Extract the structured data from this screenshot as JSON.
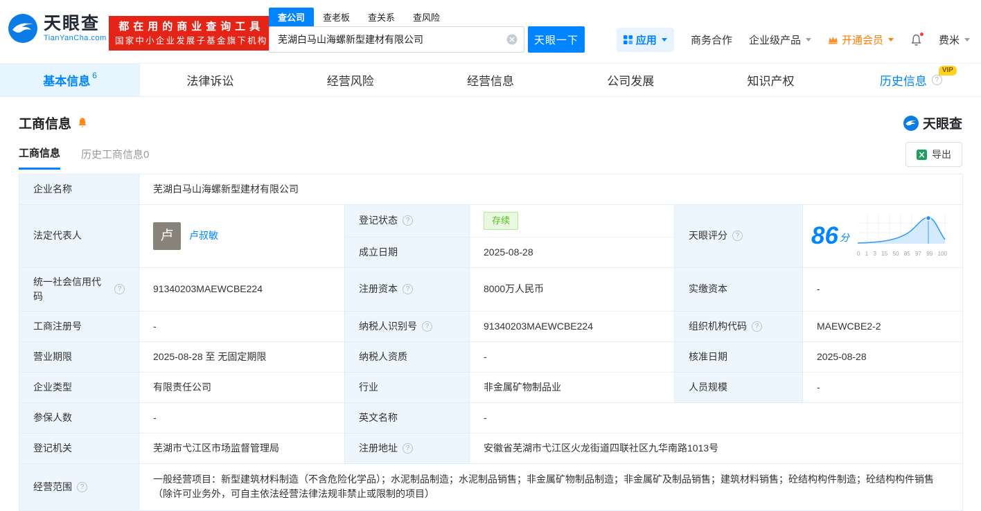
{
  "brand": {
    "name": "天眼查",
    "domain": "TianYanCha.com",
    "primary_color": "#0084ff"
  },
  "banner": {
    "line1": "都在用的商业查询工具",
    "line2": "国家中小企业发展子基金旗下机构"
  },
  "search": {
    "tabs": [
      "查公司",
      "查老板",
      "查关系",
      "查风险"
    ],
    "active_tab": "查公司",
    "value": "芜湖白马山海螺新型建材有限公司",
    "button": "天眼一下"
  },
  "topnav": {
    "apps": "应用",
    "cooperation": "商务合作",
    "enterprise_products": "企业级产品",
    "vip": "开通会员",
    "username": "费米"
  },
  "tabs": [
    {
      "label": "基本信息",
      "count": "6"
    },
    {
      "label": "法律诉讼"
    },
    {
      "label": "经营风险"
    },
    {
      "label": "经营信息"
    },
    {
      "label": "公司发展"
    },
    {
      "label": "知识产权"
    },
    {
      "label": "历史信息",
      "vip": "VIP"
    }
  ],
  "section": {
    "title": "工商信息",
    "subtab_active": "工商信息",
    "subtab_history": "历史工商信息0",
    "export_label": "导出",
    "watermark": "天眼查"
  },
  "fields": {
    "company_name": {
      "label": "企业名称",
      "value": "芜湖白马山海螺新型建材有限公司"
    },
    "legal_rep": {
      "label": "法定代表人",
      "value": "卢叔敏",
      "avatar": "卢"
    },
    "reg_status": {
      "label": "登记状态",
      "value": "存续"
    },
    "establish_date": {
      "label": "成立日期",
      "value": "2025-08-28"
    },
    "score": {
      "label": "天眼评分",
      "value": "86",
      "unit": "分",
      "ticks": [
        "0",
        "1",
        "3",
        "15",
        "50",
        "85",
        "97",
        "99",
        "100"
      ]
    },
    "credit_code": {
      "label": "统一社会信用代码",
      "value": "91340203MAEWCBE224"
    },
    "reg_capital": {
      "label": "注册资本",
      "value": "8000万人民币"
    },
    "paid_capital": {
      "label": "实缴资本",
      "value": "-"
    },
    "reg_number": {
      "label": "工商注册号",
      "value": "-"
    },
    "taxpayer_id": {
      "label": "纳税人识别号",
      "value": "91340203MAEWCBE224"
    },
    "org_code": {
      "label": "组织机构代码",
      "value": "MAEWCBE2-2"
    },
    "business_term": {
      "label": "营业期限",
      "value": "2025-08-28 至 无固定期限"
    },
    "taxpayer_quality": {
      "label": "纳税人资质",
      "value": "-"
    },
    "approval_date": {
      "label": "核准日期",
      "value": "2025-08-28"
    },
    "company_type": {
      "label": "企业类型",
      "value": "有限责任公司"
    },
    "industry": {
      "label": "行业",
      "value": "非金属矿物制品业"
    },
    "staff_size": {
      "label": "人员规模",
      "value": "-"
    },
    "insured_count": {
      "label": "参保人数",
      "value": "-"
    },
    "english_name": {
      "label": "英文名称",
      "value": "-"
    },
    "reg_authority": {
      "label": "登记机关",
      "value": "芜湖市弋江区市场监督管理局"
    },
    "reg_address": {
      "label": "注册地址",
      "value": "安徽省芜湖市弋江区火龙街道四联社区九华南路1013号"
    },
    "business_scope": {
      "label": "经营范围",
      "value": "一般经营项目：新型建筑材料制造（不含危险化学品）；水泥制品制造；水泥制品销售；非金属矿物制品制造；非金属矿及制品销售；建筑材料销售；砼结构构件制造；砼结构构件销售（除许可业务外，可自主依法经营法律法规非禁止或限制的项目）"
    }
  },
  "icons": {
    "help_glyph": "?"
  }
}
